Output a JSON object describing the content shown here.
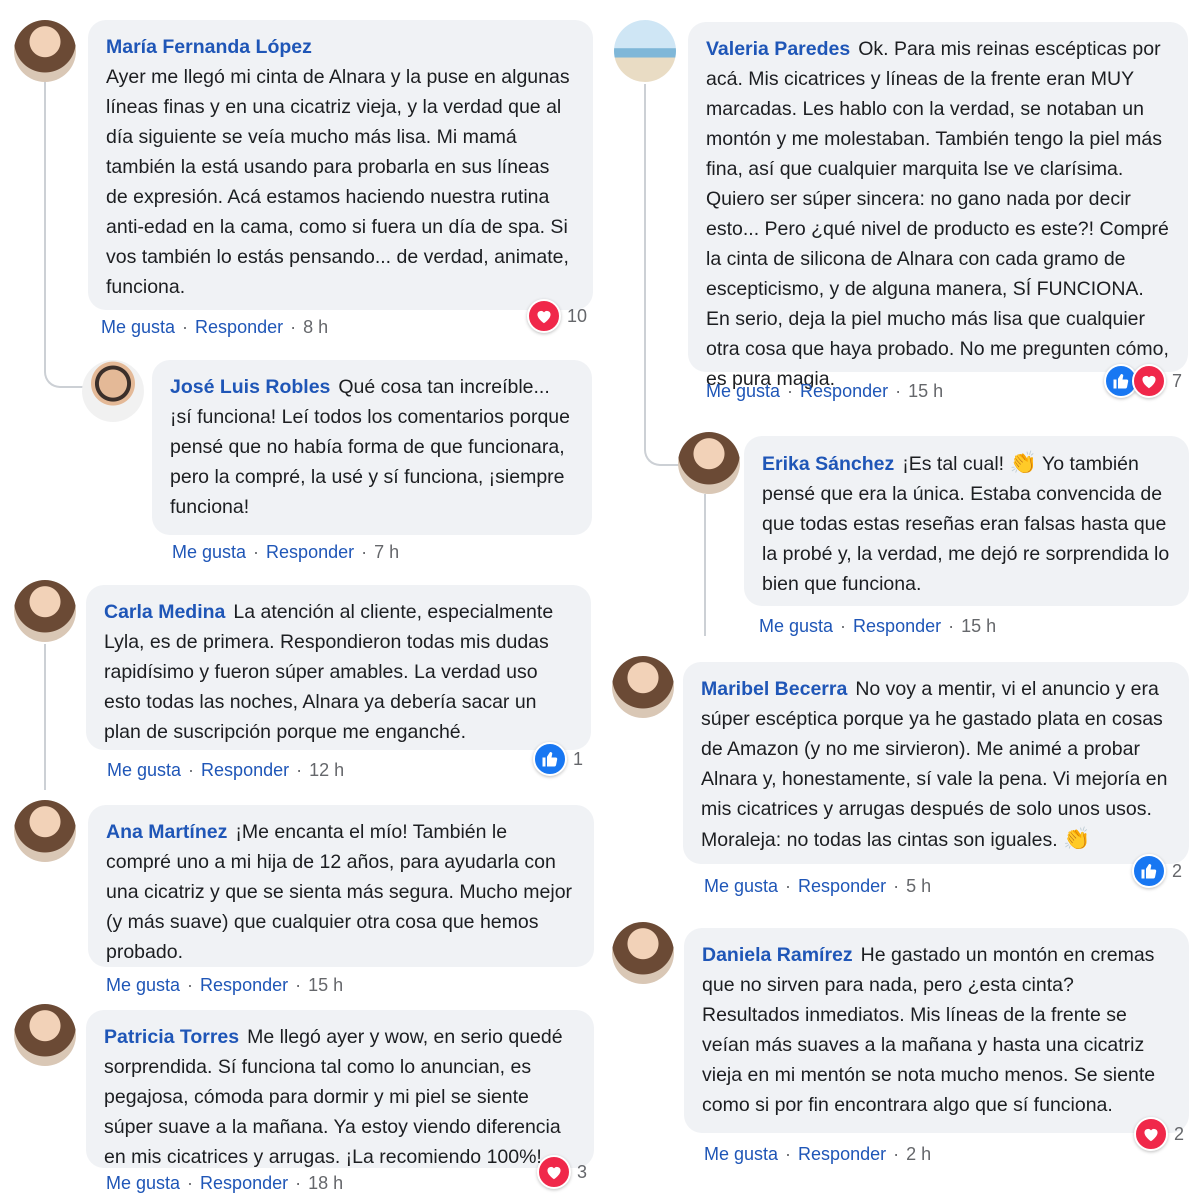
{
  "labels": {
    "like": "Me gusta",
    "reply": "Responder",
    "dot": "·"
  },
  "colors": {
    "link": "#1f56b7",
    "bubble": "#f0f2f5",
    "love": "#f0284a",
    "like": "#1877f2"
  },
  "comments": [
    {
      "name": "María Fernanda López",
      "text": "Ayer me llegó mi cinta de Alnara y la puse en algunas líneas finas y en una cicatriz vieja, y la verdad que al día siguiente se veía mucho más lisa. Mi mamá también la está usando para probarla en sus líneas de expresión. Acá estamos haciendo nuestra rutina anti-edad en la cama, como si fuera un día de spa. Si vos también lo estás pensando... de verdad, animate, funciona.",
      "time": "8 h",
      "reactions": [
        "heart-icon"
      ],
      "count": "10"
    },
    {
      "name": "José Luis Robles",
      "text": "Qué cosa tan increíble... ¡sí funciona! Leí todos los comentarios porque pensé que no había forma de que funcionara, pero la compré, la usé y sí funciona, ¡siempre funciona!",
      "time": "7 h",
      "reactions": [],
      "count": ""
    },
    {
      "name": "Carla Medina",
      "text": "La atención al cliente, especialmente Lyla, es de primera. Respondieron todas mis dudas rapidísimo y fueron súper amables. La verdad uso esto todas las noches, Alnara ya debería sacar un plan de suscripción porque me enganché.",
      "time": "12 h",
      "reactions": [
        "thumbs-up-icon"
      ],
      "count": "1"
    },
    {
      "name": "Ana Martínez",
      "text": "¡Me encanta el mío! También le compré uno a mi hija de 12 años, para ayudarla con una cicatriz y que se sienta más segura. Mucho mejor (y más suave) que cualquier otra cosa que hemos probado.",
      "time": "15 h",
      "reactions": [],
      "count": ""
    },
    {
      "name": "Patricia Torres",
      "text": "Me llegó ayer y wow, en serio quedé sorprendida. Sí funciona tal como lo anuncian, es pegajosa, cómoda para dormir y mi piel se siente súper suave a la mañana. Ya estoy viendo diferencia en mis cicatrices y arrugas. ¡La recomiendo 100%!",
      "time": "18 h",
      "reactions": [
        "heart-icon"
      ],
      "count": "3"
    },
    {
      "name": "Valeria Paredes",
      "text": "Ok. Para mis reinas escépticas por acá. Mis cicatrices y líneas de la frente eran MUY marcadas. Les hablo con la verdad, se notaban un montón y me molestaban. También tengo la piel más fina, así que cualquier marquita lse ve clarísima. Quiero ser súper sincera: no gano nada por decir esto... Pero ¿qué nivel de producto es este?! Compré la cinta de silicona de Alnara con cada gramo de escepticismo, y de alguna manera, SÍ FUNCIONA. En serio, deja la piel mucho más lisa que cualquier otra cosa que haya probado. No me pregunten cómo, es pura magia.",
      "time": "15 h",
      "reactions": [
        "thumbs-up-icon",
        "heart-icon"
      ],
      "count": "7"
    },
    {
      "name": "Erika Sánchez",
      "text_a": "¡Es tal cual!",
      "text_b": "Yo también pensé que era la única. Estaba convencida de que todas estas reseñas eran falsas hasta que la probé y, la verdad, me dejó re sorprendida lo bien que funciona.",
      "emoji": "👏",
      "time": "15 h",
      "reactions": [],
      "count": ""
    },
    {
      "name": "Maribel Becerra",
      "text": "No voy a mentir, vi el anuncio y era súper escéptica porque ya he gastado plata en cosas de Amazon (y no me sirvieron). Me animé a probar Alnara y, honestamente, sí vale la pena. Vi mejoría en mis cicatrices y arrugas después de solo unos usos. Moraleja: no todas las cintas son iguales.",
      "emoji": "👏",
      "time": "5 h",
      "reactions": [
        "thumbs-up-icon"
      ],
      "count": "2"
    },
    {
      "name": "Daniela Ramírez",
      "text": "He gastado un montón en cremas que no sirven para nada, pero ¿esta cinta? Resultados inmediatos. Mis líneas de la frente se veían más suaves a la mañana y hasta una cicatriz vieja en mi mentón se nota mucho menos. Se siente como si por fin encontrara algo que sí funciona.",
      "time": "2 h",
      "reactions": [
        "heart-icon"
      ],
      "count": "2"
    }
  ]
}
